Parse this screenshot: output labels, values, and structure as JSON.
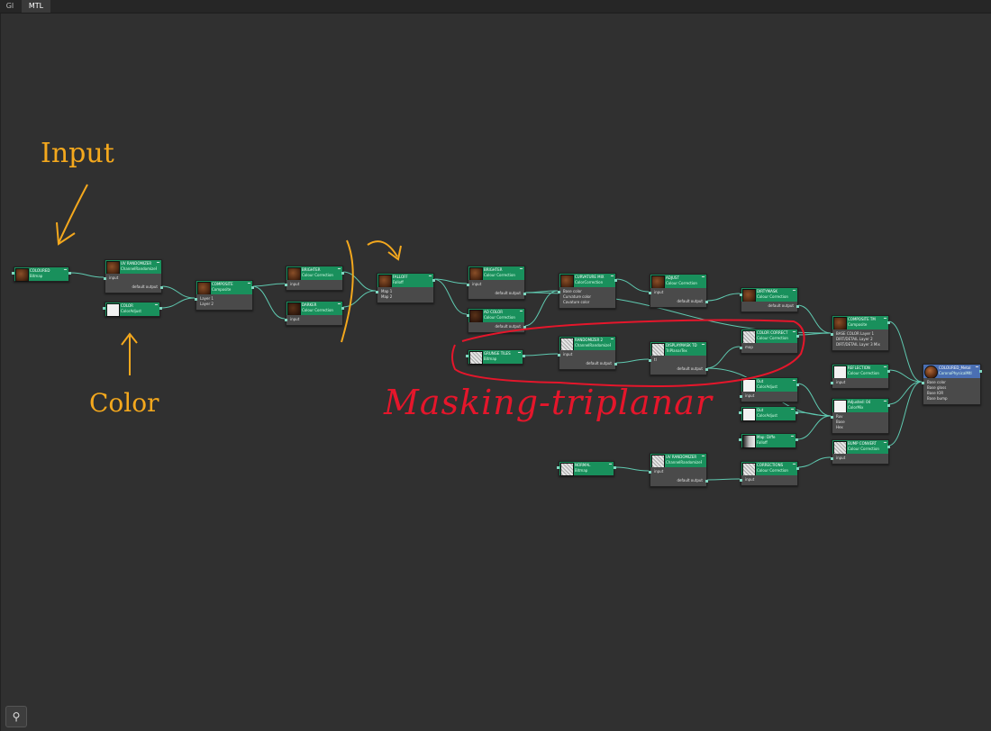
{
  "tabs": [
    {
      "label": "GI",
      "active": false
    },
    {
      "label": "MTL",
      "active": true
    }
  ],
  "annotations": {
    "input": "Input",
    "color": "Color",
    "masking": "Masking-triplanar",
    "orange_color": "#f4a81d",
    "red_color": "#e5162b"
  },
  "nodes": {
    "n1": {
      "title": "COLOURED",
      "type": "Bitmap",
      "thumb": "brown"
    },
    "n2": {
      "title": "UV RANDOMIZER",
      "type": "ChannelRandomizeRa",
      "thumb": "brown",
      "inputs": [
        "input"
      ],
      "outputs": [
        "default output"
      ]
    },
    "n3": {
      "title": "COLOR",
      "type": "ColorAdjust",
      "thumb": "white"
    },
    "n4": {
      "title": "COMPOSITE",
      "type": "Composite",
      "thumb": "brown",
      "inputs": [
        "Layer 1",
        "Layer 2"
      ]
    },
    "n5": {
      "title": "BRIGHTER",
      "type": "Colour Correction",
      "thumb": "brown",
      "inputs": [
        "input"
      ]
    },
    "n6": {
      "title": "DARKER",
      "type": "Colour Correction",
      "thumb": "dark",
      "inputs": [
        "input"
      ]
    },
    "n7": {
      "title": "FALLOFF",
      "type": "Falloff",
      "thumb": "brown",
      "inputs": [
        "Map 1",
        "Map 2"
      ]
    },
    "n8": {
      "title": "BRIGHTER",
      "type": "Colour Correction",
      "thumb": "brown",
      "inputs": [
        "input"
      ],
      "outputs": [
        "default output"
      ]
    },
    "n9": {
      "title": "AO COLOR",
      "type": "Colour Correction",
      "thumb": "dark",
      "outputs": [
        "default output"
      ]
    },
    "n10": {
      "title": "CURVATURE MIX",
      "type": "ColorCorrection",
      "thumb": "brown",
      "inputs": [
        "Base color",
        "Curvature color",
        "Cavature color"
      ]
    },
    "n11": {
      "title": "ADJUST",
      "type": "Colour Correction",
      "thumb": "brown",
      "inputs": [
        "input"
      ],
      "outputs": [
        "default output"
      ]
    },
    "n12": {
      "title": "DIRTYMASK",
      "type": "Colour Correction",
      "thumb": "brown",
      "outputs": [
        "default output"
      ]
    },
    "n13": {
      "title": "COMPOSITE TM",
      "type": "Composite",
      "thumb": "brown",
      "inputs": [
        "BASE COLOR Layer 1",
        "DIRT/DETAIL Layer 2",
        "DIRT/DETAIL Layer 3 Mix"
      ]
    },
    "n14": {
      "title": "GRUNGE TILES",
      "type": "Bitmap",
      "thumb": "speck"
    },
    "n15": {
      "title": "RANDOMIZER 2",
      "type": "ChannelRandomizeRa",
      "thumb": "speck",
      "inputs": [
        "input"
      ],
      "outputs": [
        "default output"
      ]
    },
    "n16": {
      "title": "DISPLAYMASK TD",
      "type": "TriPlanarTex",
      "thumb": "speck",
      "inputs": [
        "tl"
      ],
      "outputs": [
        "default output"
      ]
    },
    "n17": {
      "title": "COLOR CORRECT",
      "type": "Colour Correction",
      "thumb": "speck",
      "inputs": [
        "map"
      ]
    },
    "n18": {
      "title": "REFLECTION",
      "type": "Colour Correction",
      "thumb": "white",
      "inputs": [
        "input"
      ]
    },
    "n19": {
      "title": "Out",
      "type": "ColorAdjust",
      "thumb": "white",
      "inputs": [
        "input"
      ]
    },
    "n20": {
      "title": "Out",
      "type": "ColorAdjust",
      "thumb": "white"
    },
    "n21": {
      "title": "Adjusted: 04",
      "type": "ColorMix",
      "thumb": "white",
      "inputs": [
        "Ruv",
        "Base",
        "Hex"
      ]
    },
    "n22": {
      "title": "Map: Diffe",
      "type": "Falloff",
      "thumb": "grad"
    },
    "n23": {
      "title": "BUMP CONVERT",
      "type": "Colour Correction",
      "thumb": "speck",
      "inputs": [
        "input"
      ]
    },
    "n24": {
      "title": "NORMAL",
      "type": "Bitmap",
      "thumb": "speck"
    },
    "n25": {
      "title": "UV RANDOMIZER",
      "type": "ChannelRandomizeRa",
      "thumb": "speck",
      "inputs": [
        "input"
      ],
      "outputs": [
        "default output"
      ]
    },
    "n26": {
      "title": "CORRECTIONS",
      "type": "Colour Correction",
      "thumb": "speck",
      "inputs": [
        "input"
      ]
    },
    "n27": {
      "title": "COLOURED_Metal",
      "type": "CoronaPhysicalMtl",
      "thumb": "sphere",
      "inputs": [
        "Base color",
        "Base gloss",
        "Base IOR",
        "Base bump"
      ]
    }
  },
  "bottom_button_icon": "pin-icon"
}
